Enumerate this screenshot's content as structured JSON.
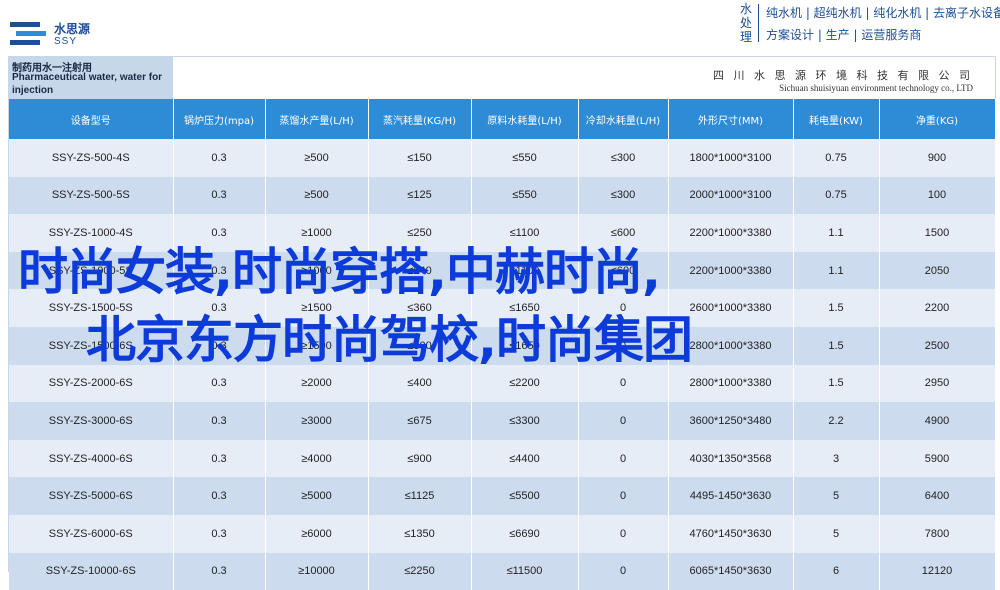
{
  "brand": {
    "name_cn": "水思源",
    "name_en": "SSY"
  },
  "slogan": {
    "vertical": "水处理",
    "line1": "纯水机 | 超纯水机 | 纯化水机 | 去离子水设备",
    "line2": "方案设计 | 生产 | 运营服务商"
  },
  "title": {
    "line1": "制药用水一注射用",
    "line2": "Pharmaceutical water, water for",
    "line3": "injection",
    "company_cn": "四 川 水 思 源 环 境 科 技 有 限 公 司",
    "company_en": "Sichuan shuisiyuan environment technology co., LTD"
  },
  "table": {
    "headers": [
      "设备型号",
      "锅炉压力(mpa)",
      "蒸馏水产量(L/H)",
      "蒸汽耗量(KG/H)",
      "原料水耗量(L/H)",
      "冷却水耗量(L/H)",
      "外形尺寸(MM)",
      "耗电量(KW)",
      "净重(KG)"
    ],
    "rows": [
      [
        "SSY-ZS-500-4S",
        "0.3",
        "≥500",
        "≤150",
        "≤550",
        "≤300",
        "1800*1000*3100",
        "0.75",
        "900"
      ],
      [
        "SSY-ZS-500-5S",
        "0.3",
        "≥500",
        "≤125",
        "≤550",
        "≤300",
        "2000*1000*3100",
        "0.75",
        "100"
      ],
      [
        "SSY-ZS-1000-4S",
        "0.3",
        "≥1000",
        "≤250",
        "≤1100",
        "≤600",
        "2200*1000*3380",
        "1.1",
        "1500"
      ],
      [
        "SSY-ZS-1000-5S",
        "0.3",
        "≥1000",
        "≤240",
        "≤1100",
        "≤600",
        "2200*1000*3380",
        "1.1",
        "2050"
      ],
      [
        "SSY-ZS-1500-5S",
        "0.3",
        "≥1500",
        "≤360",
        "≤1650",
        "0",
        "2600*1000*3380",
        "1.5",
        "2200"
      ],
      [
        "SSY-ZS-1500-6S",
        "0.3",
        "≥1500",
        "≤300",
        "≤1650",
        "0",
        "2800*1000*3380",
        "1.5",
        "2500"
      ],
      [
        "SSY-ZS-2000-6S",
        "0.3",
        "≥2000",
        "≤400",
        "≤2200",
        "0",
        "2800*1000*3380",
        "1.5",
        "2950"
      ],
      [
        "SSY-ZS-3000-6S",
        "0.3",
        "≥3000",
        "≤675",
        "≤3300",
        "0",
        "3600*1250*3480",
        "2.2",
        "4900"
      ],
      [
        "SSY-ZS-4000-6S",
        "0.3",
        "≥4000",
        "≤900",
        "≤4400",
        "0",
        "4030*1350*3568",
        "3",
        "5900"
      ],
      [
        "SSY-ZS-5000-6S",
        "0.3",
        "≥5000",
        "≤1125",
        "≤5500",
        "0",
        "4495-1450*3630",
        "5",
        "6400"
      ],
      [
        "SSY-ZS-6000-6S",
        "0.3",
        "≥6000",
        "≤1350",
        "≤6690",
        "0",
        "4760*1450*3630",
        "5",
        "7800"
      ],
      [
        "SSY-ZS-10000-6S",
        "0.3",
        "≥10000",
        "≤2250",
        "≤11500",
        "0",
        "6065*1450*3630",
        "6",
        "12120"
      ]
    ]
  },
  "overlay": {
    "line1": "时尚女装,时尚穿搭,中赫时尚,",
    "line2": "北京东方时尚驾校,时尚集团"
  }
}
